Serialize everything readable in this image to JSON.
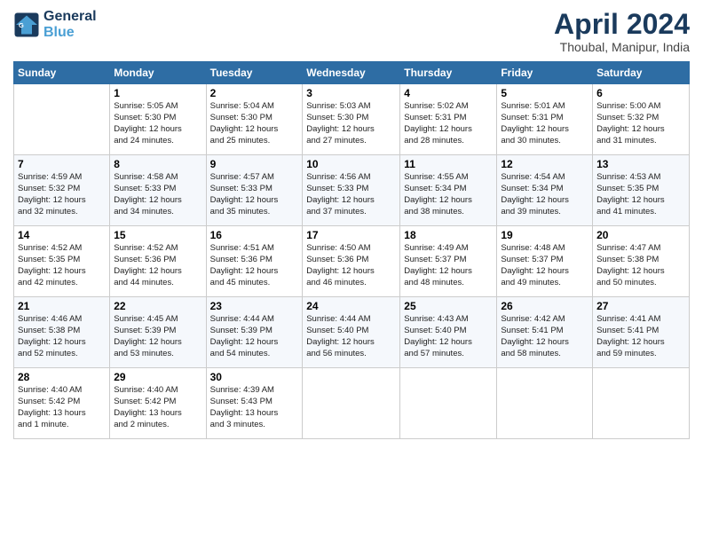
{
  "header": {
    "logo_line1": "General",
    "logo_line2": "Blue",
    "month": "April 2024",
    "location": "Thoubal, Manipur, India"
  },
  "days_of_week": [
    "Sunday",
    "Monday",
    "Tuesday",
    "Wednesday",
    "Thursday",
    "Friday",
    "Saturday"
  ],
  "weeks": [
    [
      {
        "day": "",
        "info": ""
      },
      {
        "day": "1",
        "info": "Sunrise: 5:05 AM\nSunset: 5:30 PM\nDaylight: 12 hours\nand 24 minutes."
      },
      {
        "day": "2",
        "info": "Sunrise: 5:04 AM\nSunset: 5:30 PM\nDaylight: 12 hours\nand 25 minutes."
      },
      {
        "day": "3",
        "info": "Sunrise: 5:03 AM\nSunset: 5:30 PM\nDaylight: 12 hours\nand 27 minutes."
      },
      {
        "day": "4",
        "info": "Sunrise: 5:02 AM\nSunset: 5:31 PM\nDaylight: 12 hours\nand 28 minutes."
      },
      {
        "day": "5",
        "info": "Sunrise: 5:01 AM\nSunset: 5:31 PM\nDaylight: 12 hours\nand 30 minutes."
      },
      {
        "day": "6",
        "info": "Sunrise: 5:00 AM\nSunset: 5:32 PM\nDaylight: 12 hours\nand 31 minutes."
      }
    ],
    [
      {
        "day": "7",
        "info": "Sunrise: 4:59 AM\nSunset: 5:32 PM\nDaylight: 12 hours\nand 32 minutes."
      },
      {
        "day": "8",
        "info": "Sunrise: 4:58 AM\nSunset: 5:33 PM\nDaylight: 12 hours\nand 34 minutes."
      },
      {
        "day": "9",
        "info": "Sunrise: 4:57 AM\nSunset: 5:33 PM\nDaylight: 12 hours\nand 35 minutes."
      },
      {
        "day": "10",
        "info": "Sunrise: 4:56 AM\nSunset: 5:33 PM\nDaylight: 12 hours\nand 37 minutes."
      },
      {
        "day": "11",
        "info": "Sunrise: 4:55 AM\nSunset: 5:34 PM\nDaylight: 12 hours\nand 38 minutes."
      },
      {
        "day": "12",
        "info": "Sunrise: 4:54 AM\nSunset: 5:34 PM\nDaylight: 12 hours\nand 39 minutes."
      },
      {
        "day": "13",
        "info": "Sunrise: 4:53 AM\nSunset: 5:35 PM\nDaylight: 12 hours\nand 41 minutes."
      }
    ],
    [
      {
        "day": "14",
        "info": "Sunrise: 4:52 AM\nSunset: 5:35 PM\nDaylight: 12 hours\nand 42 minutes."
      },
      {
        "day": "15",
        "info": "Sunrise: 4:52 AM\nSunset: 5:36 PM\nDaylight: 12 hours\nand 44 minutes."
      },
      {
        "day": "16",
        "info": "Sunrise: 4:51 AM\nSunset: 5:36 PM\nDaylight: 12 hours\nand 45 minutes."
      },
      {
        "day": "17",
        "info": "Sunrise: 4:50 AM\nSunset: 5:36 PM\nDaylight: 12 hours\nand 46 minutes."
      },
      {
        "day": "18",
        "info": "Sunrise: 4:49 AM\nSunset: 5:37 PM\nDaylight: 12 hours\nand 48 minutes."
      },
      {
        "day": "19",
        "info": "Sunrise: 4:48 AM\nSunset: 5:37 PM\nDaylight: 12 hours\nand 49 minutes."
      },
      {
        "day": "20",
        "info": "Sunrise: 4:47 AM\nSunset: 5:38 PM\nDaylight: 12 hours\nand 50 minutes."
      }
    ],
    [
      {
        "day": "21",
        "info": "Sunrise: 4:46 AM\nSunset: 5:38 PM\nDaylight: 12 hours\nand 52 minutes."
      },
      {
        "day": "22",
        "info": "Sunrise: 4:45 AM\nSunset: 5:39 PM\nDaylight: 12 hours\nand 53 minutes."
      },
      {
        "day": "23",
        "info": "Sunrise: 4:44 AM\nSunset: 5:39 PM\nDaylight: 12 hours\nand 54 minutes."
      },
      {
        "day": "24",
        "info": "Sunrise: 4:44 AM\nSunset: 5:40 PM\nDaylight: 12 hours\nand 56 minutes."
      },
      {
        "day": "25",
        "info": "Sunrise: 4:43 AM\nSunset: 5:40 PM\nDaylight: 12 hours\nand 57 minutes."
      },
      {
        "day": "26",
        "info": "Sunrise: 4:42 AM\nSunset: 5:41 PM\nDaylight: 12 hours\nand 58 minutes."
      },
      {
        "day": "27",
        "info": "Sunrise: 4:41 AM\nSunset: 5:41 PM\nDaylight: 12 hours\nand 59 minutes."
      }
    ],
    [
      {
        "day": "28",
        "info": "Sunrise: 4:40 AM\nSunset: 5:42 PM\nDaylight: 13 hours\nand 1 minute."
      },
      {
        "day": "29",
        "info": "Sunrise: 4:40 AM\nSunset: 5:42 PM\nDaylight: 13 hours\nand 2 minutes."
      },
      {
        "day": "30",
        "info": "Sunrise: 4:39 AM\nSunset: 5:43 PM\nDaylight: 13 hours\nand 3 minutes."
      },
      {
        "day": "",
        "info": ""
      },
      {
        "day": "",
        "info": ""
      },
      {
        "day": "",
        "info": ""
      },
      {
        "day": "",
        "info": ""
      }
    ]
  ]
}
